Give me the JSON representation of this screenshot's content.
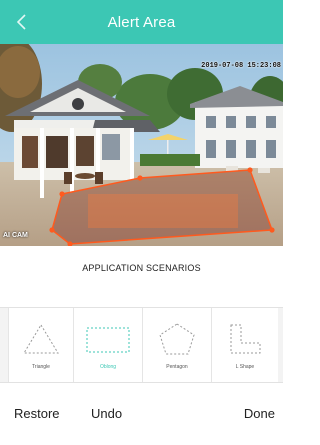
{
  "header": {
    "title": "Alert Area",
    "back_icon": "chevron-left-icon",
    "color": "#3cc7b4"
  },
  "camera": {
    "timestamp": "2019-07-08 15:23:08",
    "label": "AI CAM",
    "zone_color": "#ff5a1e"
  },
  "scenarios_label": "APPLICATION SCENARIOS",
  "shapes": [
    {
      "label": "Triangle",
      "icon": "triangle-icon",
      "selected": false
    },
    {
      "label": "Oblong",
      "icon": "rectangle-icon",
      "selected": true
    },
    {
      "label": "Pentagon",
      "icon": "pentagon-icon",
      "selected": false
    },
    {
      "label": "L Shape",
      "icon": "l-shape-icon",
      "selected": false
    }
  ],
  "footer": {
    "restore": "Restore",
    "undo": "Undo",
    "done": "Done"
  },
  "accent_color": "#3cc7b4"
}
